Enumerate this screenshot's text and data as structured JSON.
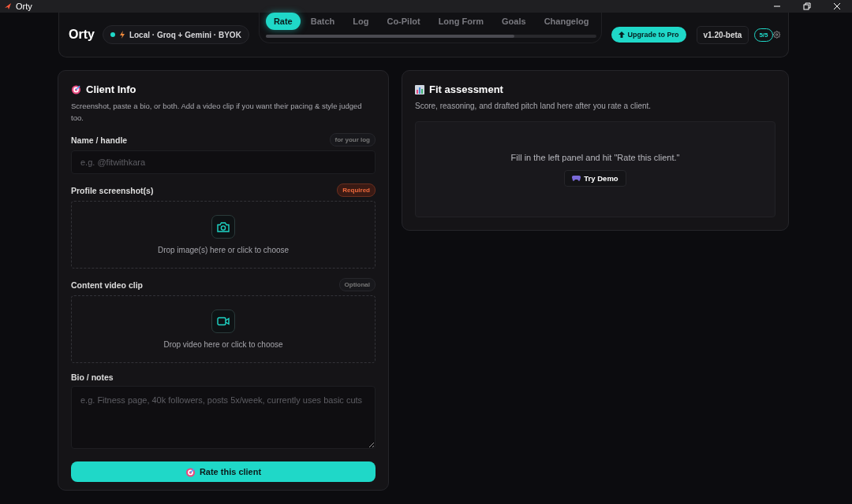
{
  "window": {
    "title": "Orty"
  },
  "header": {
    "brand": "Orty",
    "status": {
      "label": "Local · Groq + Gemini · BYOK",
      "online": true
    },
    "tabs": [
      {
        "label": "Rate",
        "selected": true
      },
      {
        "label": "Batch",
        "selected": false
      },
      {
        "label": "Log",
        "selected": false
      },
      {
        "label": "Co-Pilot",
        "selected": false
      },
      {
        "label": "Long Form",
        "selected": false
      },
      {
        "label": "Goals",
        "selected": false
      },
      {
        "label": "Changelog",
        "selected": false
      }
    ],
    "upgrade_button": "Upgrade to Pro",
    "version": "v1.20-beta",
    "quota": "5/5"
  },
  "client_info": {
    "title": "Client Info",
    "description": "Screenshot, paste a bio, or both. Add a video clip if you want their pacing & style judged too.",
    "fields": [
      {
        "kind": "input",
        "label": "Name / handle",
        "tag": "for your log",
        "placeholder": "e.g. @fitwithkara"
      },
      {
        "kind": "image_drop",
        "label": "Profile screenshot(s)",
        "tag": "Required",
        "required": true,
        "hint": "Drop image(s) here or click to choose"
      },
      {
        "kind": "video_drop",
        "label": "Content video clip",
        "tag": "Optional",
        "required": false,
        "hint": "Drop video here or click to choose"
      },
      {
        "kind": "textarea",
        "label": "Bio / notes",
        "placeholder": "e.g. Fitness page, 40k followers, posts 5x/week, currently uses basic cuts"
      }
    ],
    "submit": "Rate this client"
  },
  "fit_assessment": {
    "title": "Fit assessment",
    "description": "Score, reasoning, and drafted pitch land here after you rate a client.",
    "empty_message": "Fill in the left panel and hit \"Rate this client.\"",
    "demo_button": "Try Demo"
  }
}
